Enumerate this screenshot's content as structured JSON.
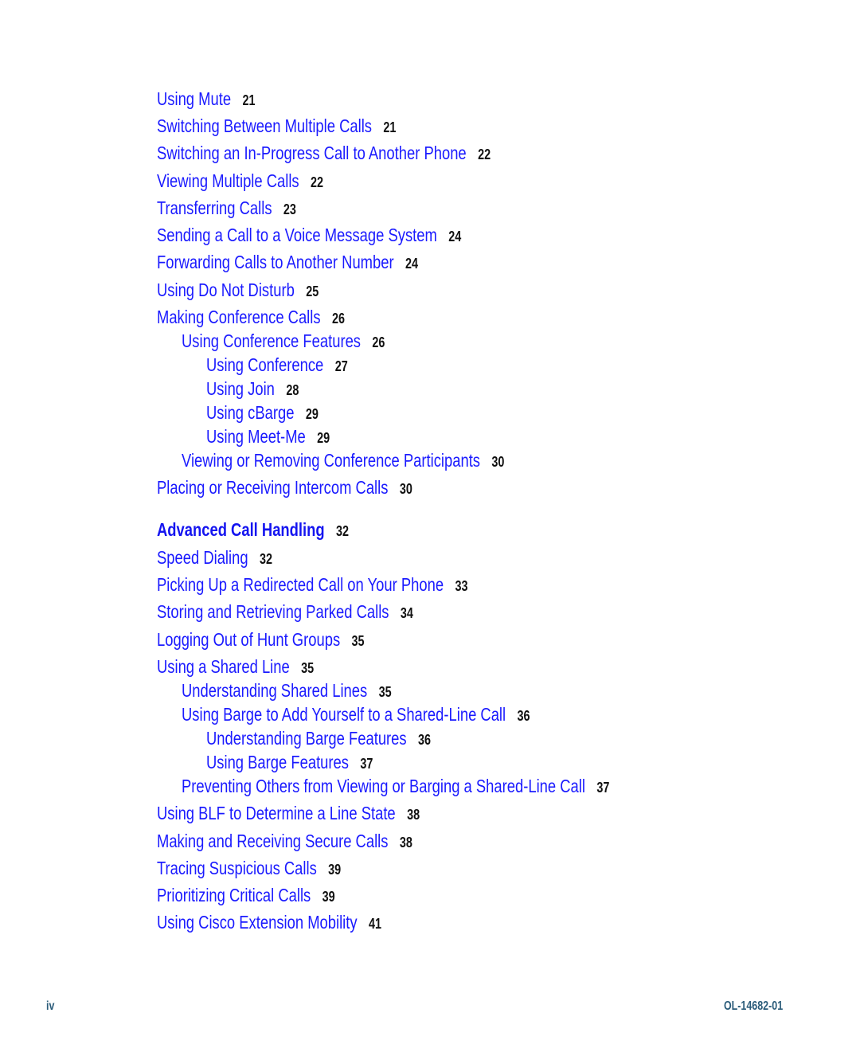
{
  "toc": {
    "entries": [
      {
        "level": 1,
        "title": "Using Mute",
        "page": "21"
      },
      {
        "level": 1,
        "title": "Switching Between Multiple Calls",
        "page": "21"
      },
      {
        "level": 1,
        "title": "Switching an In-Progress Call to Another Phone",
        "page": "22"
      },
      {
        "level": 1,
        "title": "Viewing Multiple Calls",
        "page": "22"
      },
      {
        "level": 1,
        "title": "Transferring Calls",
        "page": "23"
      },
      {
        "level": 1,
        "title": "Sending a Call to a Voice Message System",
        "page": "24"
      },
      {
        "level": 1,
        "title": "Forwarding Calls to Another Number",
        "page": "24"
      },
      {
        "level": 1,
        "title": "Using Do Not Disturb",
        "page": "25"
      },
      {
        "level": 1,
        "title": "Making Conference Calls",
        "page": "26"
      },
      {
        "level": 2,
        "title": "Using Conference Features",
        "page": "26"
      },
      {
        "level": 3,
        "title": "Using Conference",
        "page": "27"
      },
      {
        "level": 3,
        "title": "Using Join",
        "page": "28"
      },
      {
        "level": 3,
        "title": "Using cBarge",
        "page": "29"
      },
      {
        "level": 3,
        "title": "Using Meet-Me",
        "page": "29"
      },
      {
        "level": 2,
        "title": "Viewing or Removing Conference Participants",
        "page": "30"
      },
      {
        "level": 1,
        "title": "Placing or Receiving Intercom Calls",
        "page": "30"
      },
      {
        "level": 0,
        "title": "Advanced Call Handling",
        "page": "32"
      },
      {
        "level": 1,
        "title": "Speed Dialing",
        "page": "32"
      },
      {
        "level": 1,
        "title": "Picking Up a Redirected Call on Your Phone",
        "page": "33"
      },
      {
        "level": 1,
        "title": "Storing and Retrieving Parked Calls",
        "page": "34"
      },
      {
        "level": 1,
        "title": "Logging Out of Hunt Groups",
        "page": "35"
      },
      {
        "level": 1,
        "title": "Using a Shared Line",
        "page": "35"
      },
      {
        "level": 2,
        "title": "Understanding Shared Lines",
        "page": "35"
      },
      {
        "level": 2,
        "title": "Using Barge to Add Yourself to a Shared-Line Call",
        "page": "36"
      },
      {
        "level": 3,
        "title": "Understanding Barge Features",
        "page": "36"
      },
      {
        "level": 3,
        "title": "Using Barge Features",
        "page": "37"
      },
      {
        "level": 2,
        "title": "Preventing Others from Viewing or Barging a Shared-Line Call",
        "page": "37"
      },
      {
        "level": 1,
        "title": "Using BLF to Determine a Line State",
        "page": "38"
      },
      {
        "level": 1,
        "title": "Making and Receiving Secure Calls",
        "page": "38"
      },
      {
        "level": 1,
        "title": "Tracing Suspicious Calls",
        "page": "39"
      },
      {
        "level": 1,
        "title": "Prioritizing Critical Calls",
        "page": "39"
      },
      {
        "level": 1,
        "title": "Using Cisco Extension Mobility",
        "page": "41"
      }
    ]
  },
  "footer": {
    "page_number": "iv",
    "doc_id": "OL-14682-01"
  },
  "colors": {
    "link": "#1a1aff",
    "page_number": "#111111",
    "footer": "#2b5c7a"
  }
}
